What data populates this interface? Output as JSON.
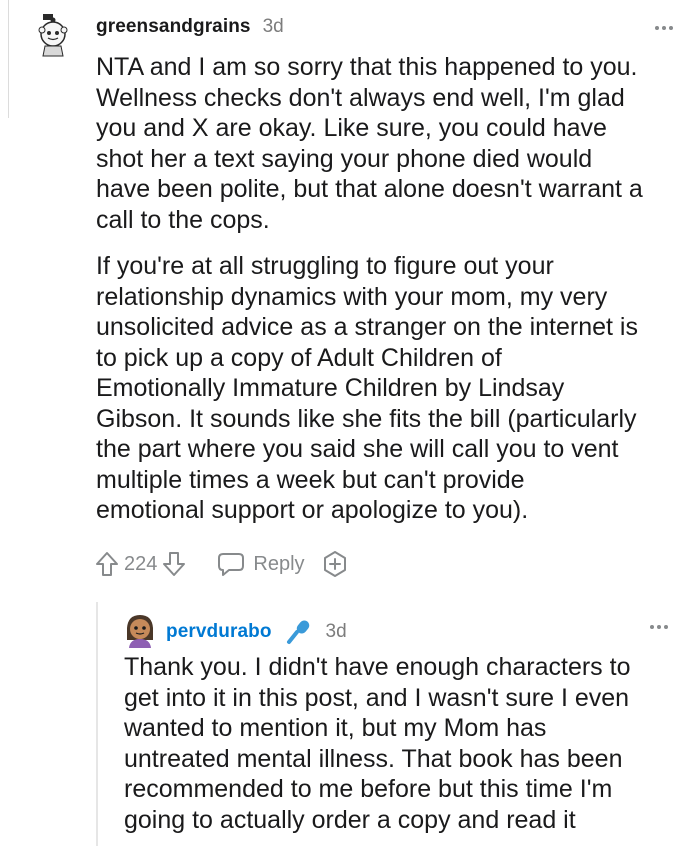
{
  "comment": {
    "username": "greensandgrains",
    "time": "3d",
    "paragraphs": [
      [
        "NTA and I am so sorry that this happened to you.",
        "Wellness checks don't always end well, I'm glad",
        "you and X are okay. Like sure, you could have",
        "shot her a text saying your phone died would",
        "have been polite, but that alone doesn't warrant a",
        "call to the cops."
      ],
      [
        "If you're at all struggling to figure out your",
        "relationship dynamics with your mom, my very",
        "unsolicited advice as a stranger on the internet is",
        "to pick up a copy of Adult Children of",
        "Emotionally Immature Children by Lindsay",
        "Gibson. It sounds like she fits the bill (particularly",
        "the part where you said she will call you to vent",
        "multiple times a week but can't provide",
        "emotional support or apologize to you)."
      ]
    ],
    "votes": "224",
    "reply_label": "Reply"
  },
  "reply": {
    "username": "pervdurabo",
    "time": "3d",
    "lines": [
      "Thank you. I didn't have enough characters to",
      "get into it in this post, and I wasn't sure I even",
      "wanted to mention it, but my Mom has",
      "untreated mental illness. That book has been",
      "recommended to me before but this time I'm",
      "going to actually order a copy and read it"
    ]
  },
  "icons": {
    "avatar_1": "snoo-avatar-icon",
    "avatar_2": "snoo-avatar-icon",
    "more": "more-options-icon",
    "upvote": "upvote-arrow-icon",
    "downvote": "downvote-arrow-icon",
    "reply": "chat-bubble-icon",
    "award": "award-plus-icon",
    "flair": "microphone-icon"
  },
  "colors": {
    "text": "#1a1a1b",
    "meta": "#7c7c7c",
    "reply_username": "#0079d3",
    "action_gray": "#878a8c"
  }
}
